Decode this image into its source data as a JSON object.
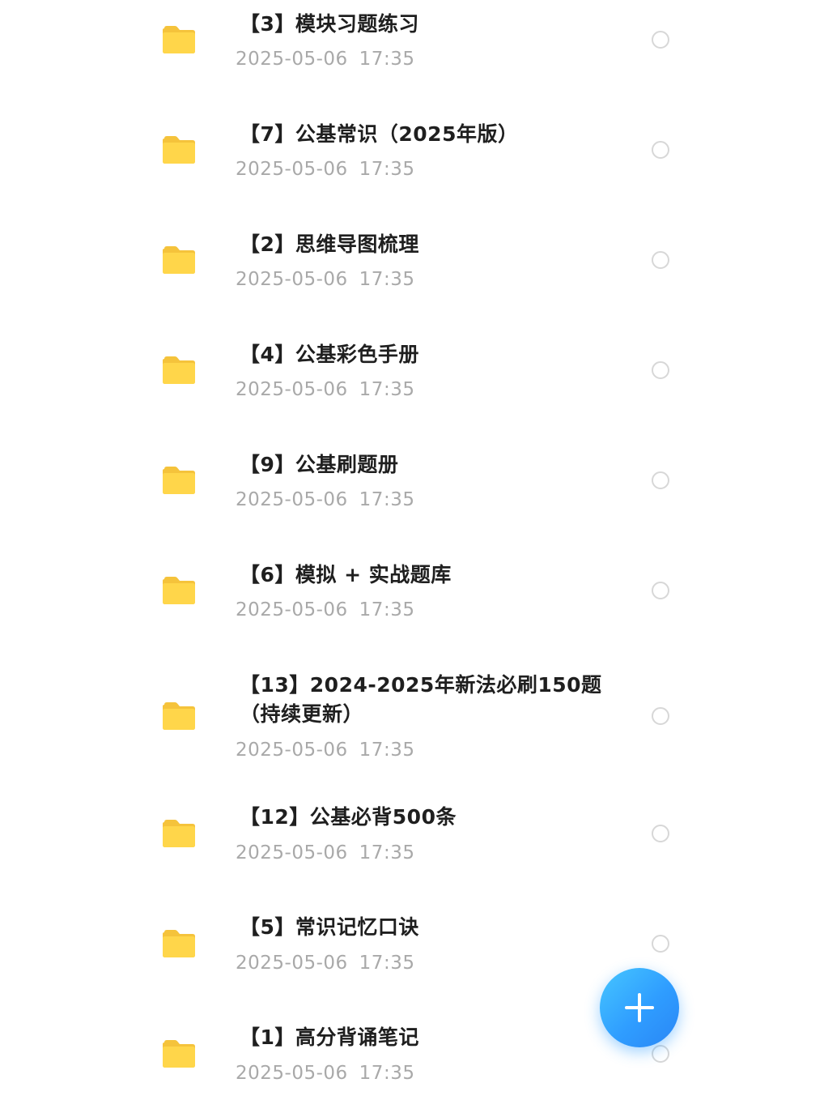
{
  "files": [
    {
      "title": "【3】模块习题练习",
      "date": "2025-05-06",
      "time": "17:35"
    },
    {
      "title": "【7】公基常识（2025年版）",
      "date": "2025-05-06",
      "time": "17:35"
    },
    {
      "title": "【2】思维导图梳理",
      "date": "2025-05-06",
      "time": "17:35"
    },
    {
      "title": "【4】公基彩色手册",
      "date": "2025-05-06",
      "time": "17:35"
    },
    {
      "title": "【9】公基刷题册",
      "date": "2025-05-06",
      "time": "17:35"
    },
    {
      "title": "【6】模拟 + 实战题库",
      "date": "2025-05-06",
      "time": "17:35"
    },
    {
      "title": "【13】2024-2025年新法必刷150题（持续更新）",
      "date": "2025-05-06",
      "time": "17:35"
    },
    {
      "title": "【12】公基必背500条",
      "date": "2025-05-06",
      "time": "17:35"
    },
    {
      "title": "【5】常识记忆口诀",
      "date": "2025-05-06",
      "time": "17:35"
    },
    {
      "title": "【1】高分背诵笔记",
      "date": "2025-05-06",
      "time": "17:35"
    }
  ],
  "icons": {
    "folder": "folder-icon",
    "select": "radio-unchecked-icon",
    "add": "plus-icon"
  },
  "colors": {
    "folder": "#ffd64a",
    "accent": "#2f9dff",
    "title_text": "#1f1f1f",
    "date_text": "#a9a9a9"
  }
}
